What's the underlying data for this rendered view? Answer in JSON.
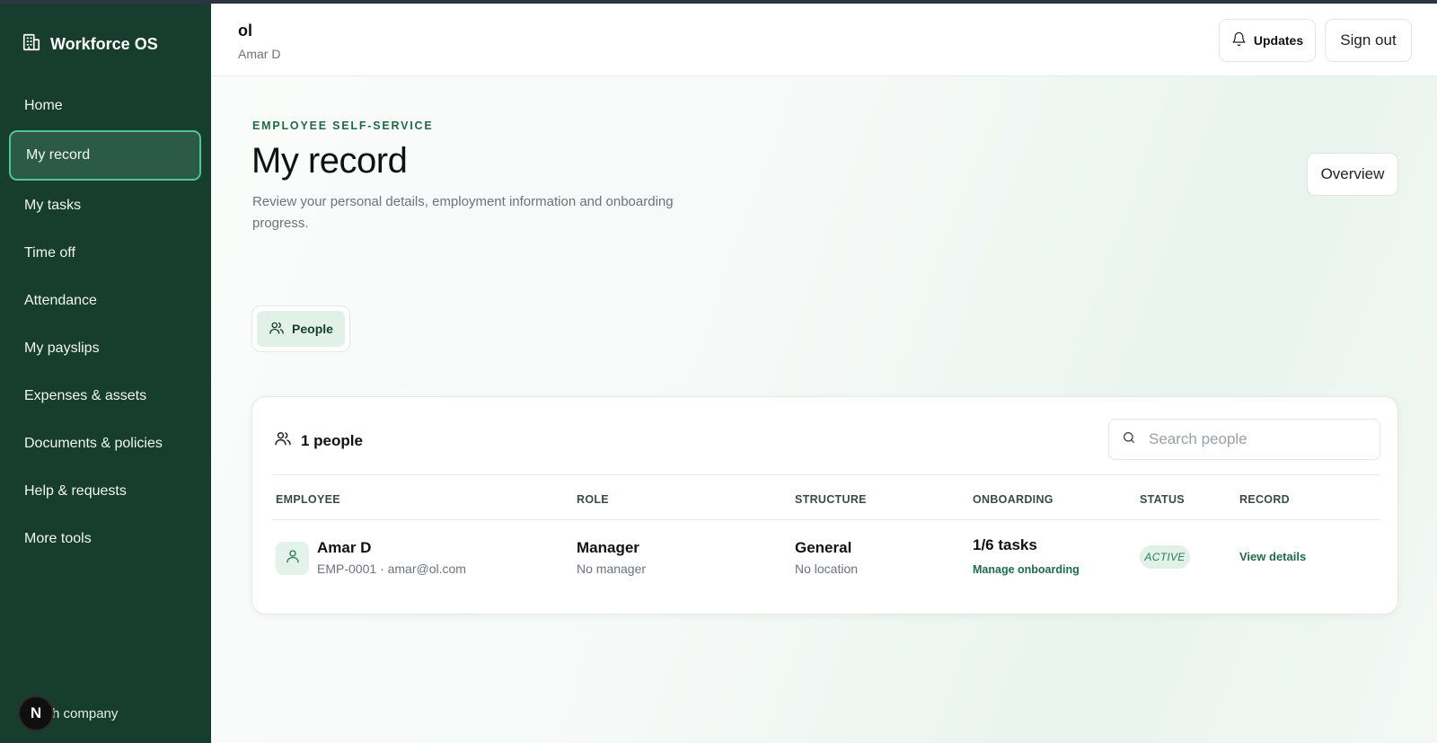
{
  "sidebar": {
    "brand": "Workforce OS",
    "items": [
      {
        "label": "Home"
      },
      {
        "label": "My record"
      },
      {
        "label": "My tasks"
      },
      {
        "label": "Time off"
      },
      {
        "label": "Attendance"
      },
      {
        "label": "My payslips"
      },
      {
        "label": "Expenses & assets"
      },
      {
        "label": "Documents & policies"
      },
      {
        "label": "Help & requests"
      },
      {
        "label": "More tools"
      }
    ],
    "active_item": "My record",
    "footer_avatar": "N",
    "footer_text": "h company"
  },
  "header": {
    "org": "ol",
    "user": "Amar D",
    "updates_label": "Updates",
    "signout_label": "Sign out"
  },
  "page": {
    "eyebrow": "EMPLOYEE SELF-SERVICE",
    "title": "My record",
    "description": "Review your personal details, employment information and onboarding progress.",
    "overview_label": "Overview",
    "tab_people": "People"
  },
  "card": {
    "count_label": "1 people",
    "search_placeholder": "Search people",
    "columns": [
      "EMPLOYEE",
      "ROLE",
      "STRUCTURE",
      "ONBOARDING",
      "STATUS",
      "RECORD"
    ],
    "rows": [
      {
        "name": "Amar D",
        "meta": "EMP-0001 · amar@ol.com",
        "role": "Manager",
        "manager": "No manager",
        "structure": "General",
        "location": "No location",
        "onboarding": "1/6 tasks",
        "onboarding_link": "Manage onboarding",
        "status": "ACTIVE",
        "record_link": "View details"
      }
    ]
  },
  "colors": {
    "sidebar_bg": "#163d2e",
    "accent": "#1f6b47",
    "active_border": "#4fc497"
  }
}
